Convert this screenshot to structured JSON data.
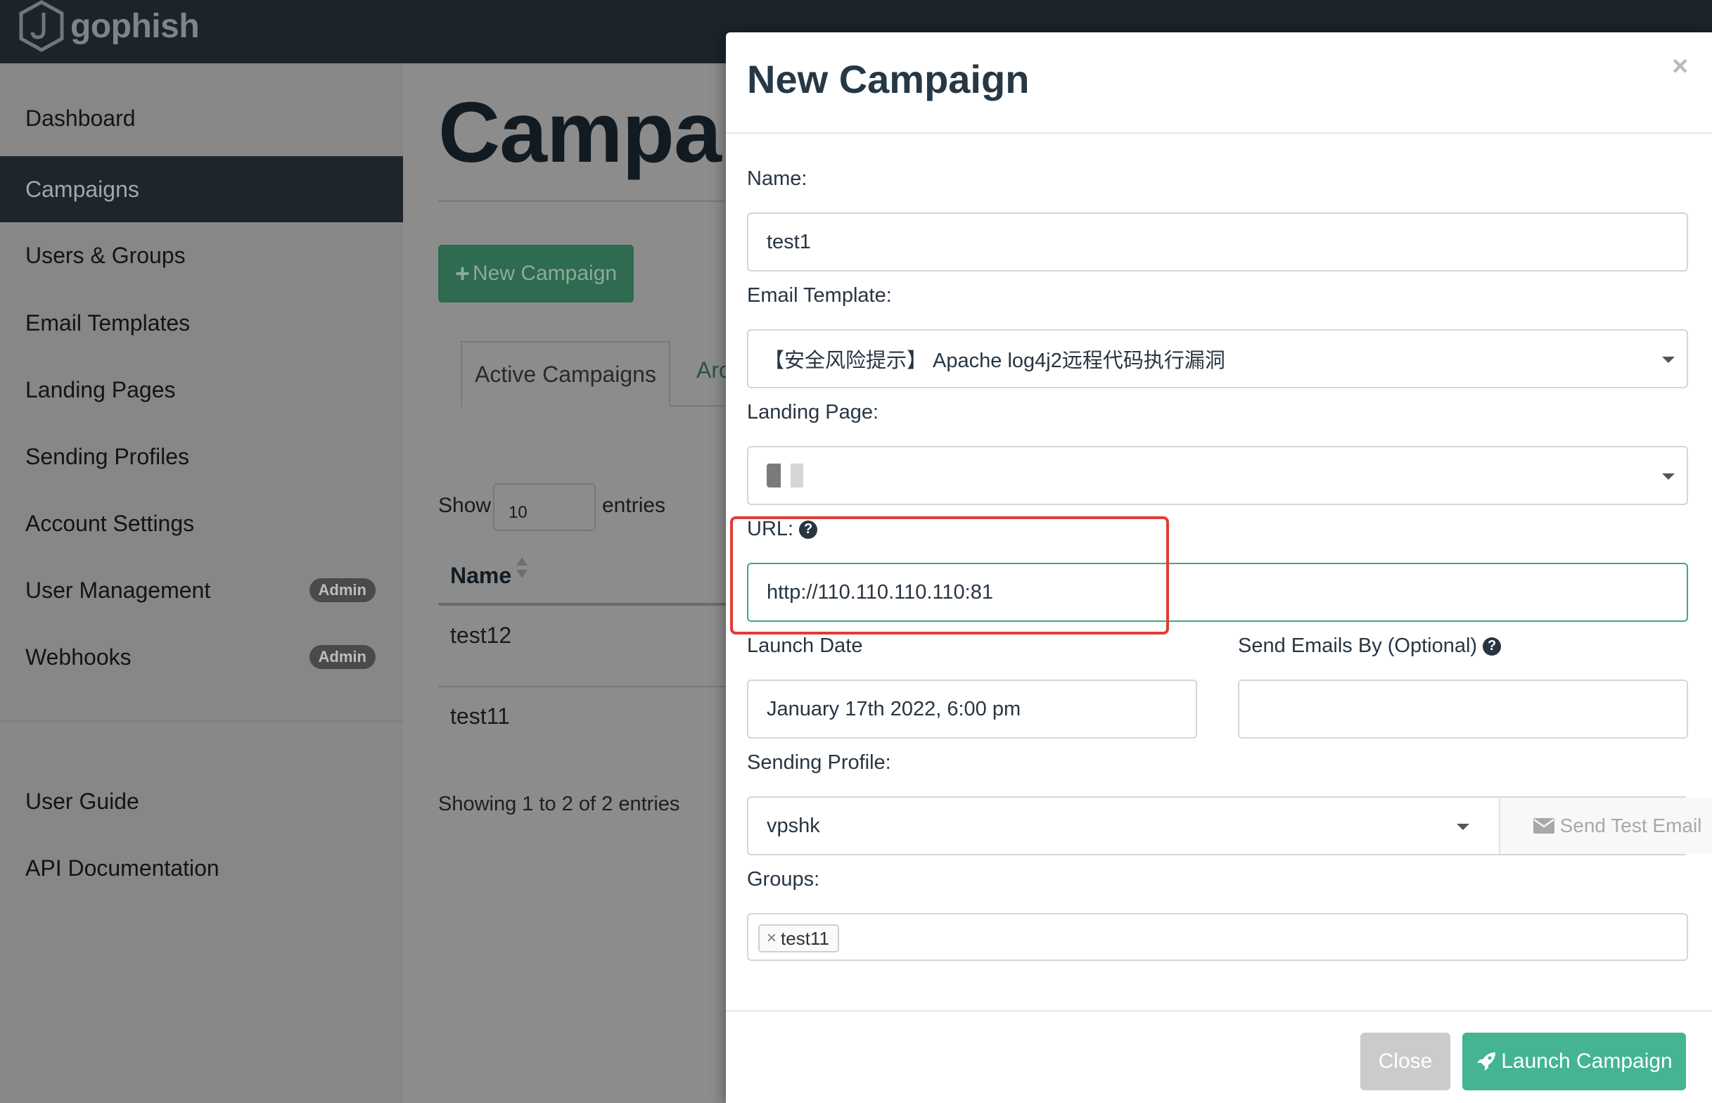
{
  "app": {
    "brand": "gophish",
    "accent": "#45b492",
    "nav_active_bg": "#1e252b"
  },
  "sidebar": {
    "items": [
      {
        "label": "Dashboard"
      },
      {
        "label": "Campaigns",
        "active": true
      },
      {
        "label": "Users & Groups"
      },
      {
        "label": "Email Templates"
      },
      {
        "label": "Landing Pages"
      },
      {
        "label": "Sending Profiles"
      },
      {
        "label": "Account Settings"
      },
      {
        "label": "User Management",
        "badge": "Admin"
      },
      {
        "label": "Webhooks",
        "badge": "Admin"
      }
    ],
    "secondary": [
      {
        "label": "User Guide"
      },
      {
        "label": "API Documentation"
      }
    ]
  },
  "main": {
    "title": "Campai",
    "new_campaign_label": "New Campaign",
    "tabs": [
      {
        "label": "Active Campaigns"
      },
      {
        "label": "Arc"
      }
    ],
    "show_label": "Show",
    "page_size": "10",
    "entries_label": "entries",
    "table": {
      "columns": [
        "Name"
      ],
      "rows": [
        {
          "name": "test12"
        },
        {
          "name": "test11"
        }
      ]
    },
    "showing_text": "Showing 1 to 2 of 2 entries"
  },
  "modal": {
    "title": "New Campaign",
    "close_glyph": "×",
    "name_label": "Name:",
    "name_value": "test1",
    "email_template_label": "Email Template:",
    "email_template_value": "【安全风险提示】 Apache log4j2远程代码执行漏洞",
    "landing_page_label": "Landing Page:",
    "url_label": "URL:",
    "url_value": "http://110.110.110.110:81",
    "launch_date_label": "Launch Date",
    "launch_date_value": "January 17th 2022, 6:00 pm",
    "send_by_label": "Send Emails By (Optional)",
    "send_by_value": "",
    "sending_profile_label": "Sending Profile:",
    "sending_profile_value": "vpshk",
    "send_test_label": "Send Test Email",
    "groups_label": "Groups:",
    "groups": [
      {
        "label": "test11",
        "remove_glyph": "×"
      }
    ],
    "close_button": "Close",
    "launch_button": "Launch Campaign"
  }
}
